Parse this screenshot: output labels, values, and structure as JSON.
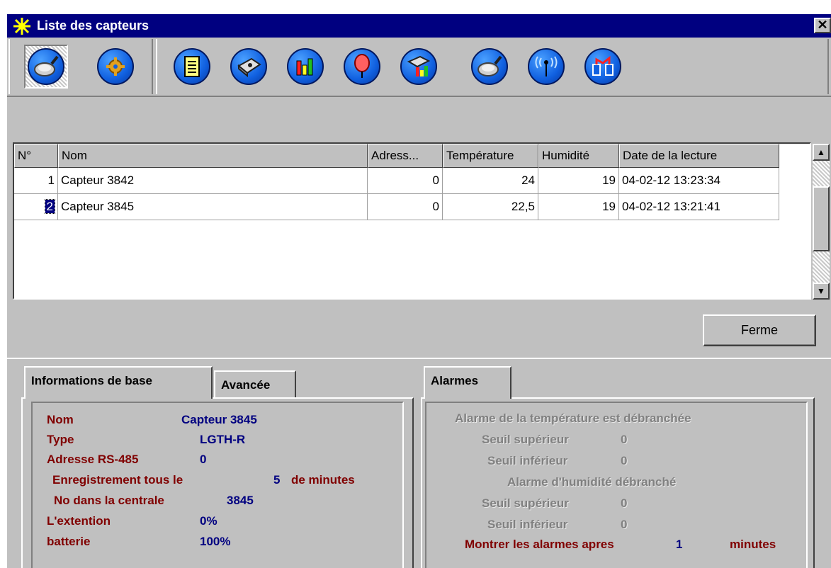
{
  "window": {
    "title": "Liste des capteurs",
    "close_glyph": "✕"
  },
  "toolbar": {
    "buttons": [
      {
        "icon": "magnifier-icon",
        "pressed": true
      },
      {
        "icon": "gear-icon"
      },
      {
        "icon": "document-icon"
      },
      {
        "icon": "device-icon"
      },
      {
        "icon": "bar-chart-icon"
      },
      {
        "icon": "alarm-balloon-icon"
      },
      {
        "icon": "device-chart-icon"
      },
      {
        "icon": "magnifier-icon"
      },
      {
        "icon": "antenna-icon"
      },
      {
        "icon": "network-icon"
      }
    ]
  },
  "grid": {
    "columns": [
      "N°",
      "Nom",
      "Adress...",
      "Température",
      "Humidité",
      "Date de la lecture"
    ],
    "rows": [
      {
        "num": "1",
        "name": "Capteur 3842",
        "address": "0",
        "temperature": "24",
        "humidity": "19",
        "date": "04-02-12 13:23:34"
      },
      {
        "num": "2",
        "name": "Capteur 3845",
        "address": "0",
        "temperature": "22,5",
        "humidity": "19",
        "date": "04-02-12 13:21:41"
      }
    ],
    "selected_row": 1
  },
  "buttons": {
    "close": "Ferme"
  },
  "tabs_left": {
    "basic": "Informations de base",
    "advanced": "Avancée"
  },
  "tabs_right": {
    "alarms": "Alarmes"
  },
  "info": {
    "name_label": "Nom",
    "name_value": "Capteur 3845",
    "type_label": "Type",
    "type_value": "LGTH-R",
    "address_label": "Adresse RS-485",
    "address_value": "0",
    "record_label": "Enregistrement tous le",
    "record_value": "5",
    "record_unit": "de minutes",
    "central_label": "No dans la centrale",
    "central_value": "3845",
    "extension_label": "L'extention",
    "extension_value": "0%",
    "battery_label": "batterie",
    "battery_value": "100%"
  },
  "alarms": {
    "temp_status": "Alarme de la température est débranchée",
    "upper_label": "Seuil supérieur",
    "upper_value": "0",
    "lower_label": "Seuil inférieur",
    "lower_value": "0",
    "hum_status": "Alarme d'humidité débranché",
    "hum_upper_label": "Seuil supérieur",
    "hum_upper_value": "0",
    "hum_lower_label": "Seuil inférieur",
    "hum_lower_value": "0",
    "show_label": "Montrer les alarmes apres",
    "show_value": "1",
    "show_unit": "minutes"
  }
}
